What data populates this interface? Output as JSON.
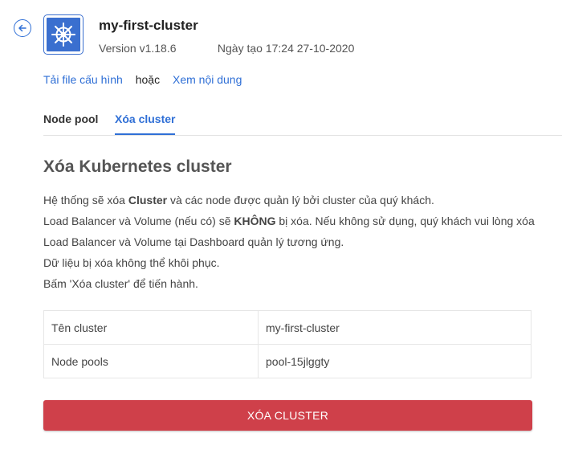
{
  "header": {
    "back_icon": "arrow-left-circle-icon",
    "logo_icon": "kubernetes-helm-icon",
    "cluster_name": "my-first-cluster",
    "version": "Version v1.18.6",
    "created": "Ngày tạo 17:24 27-10-2020"
  },
  "links": {
    "download_config": "Tải file cấu hình",
    "separator": "hoặc",
    "view_content": "Xem nội dung"
  },
  "tabs": [
    {
      "label": "Node pool",
      "active": false
    },
    {
      "label": "Xóa cluster",
      "active": true
    }
  ],
  "main": {
    "title": "Xóa Kubernetes cluster",
    "line1": {
      "pre": "Hệ thống sẽ xóa ",
      "bold": "Cluster",
      "post": " và các node được quản lý bởi cluster của quý khách."
    },
    "line2": {
      "pre": "Load Balancer và Volume (nếu có) sẽ ",
      "bold": "KHÔNG",
      "post": " bị xóa. Nếu không sử dụng, quý khách vui lòng xóa Load Balancer và Volume tại Dashboard quản lý tương ứng."
    },
    "line3": "Dữ liệu bị xóa không thể khôi phục.",
    "line4": "Bấm 'Xóa cluster' để tiến hành."
  },
  "info_table": [
    {
      "label": "Tên cluster",
      "value": "my-first-cluster"
    },
    {
      "label": "Node pools",
      "value": "pool-15jlggty"
    }
  ],
  "delete_button": "XÓA CLUSTER",
  "colors": {
    "accent": "#2f6fd6",
    "danger": "#cf404a",
    "logo_bg": "#3a6fcf"
  }
}
